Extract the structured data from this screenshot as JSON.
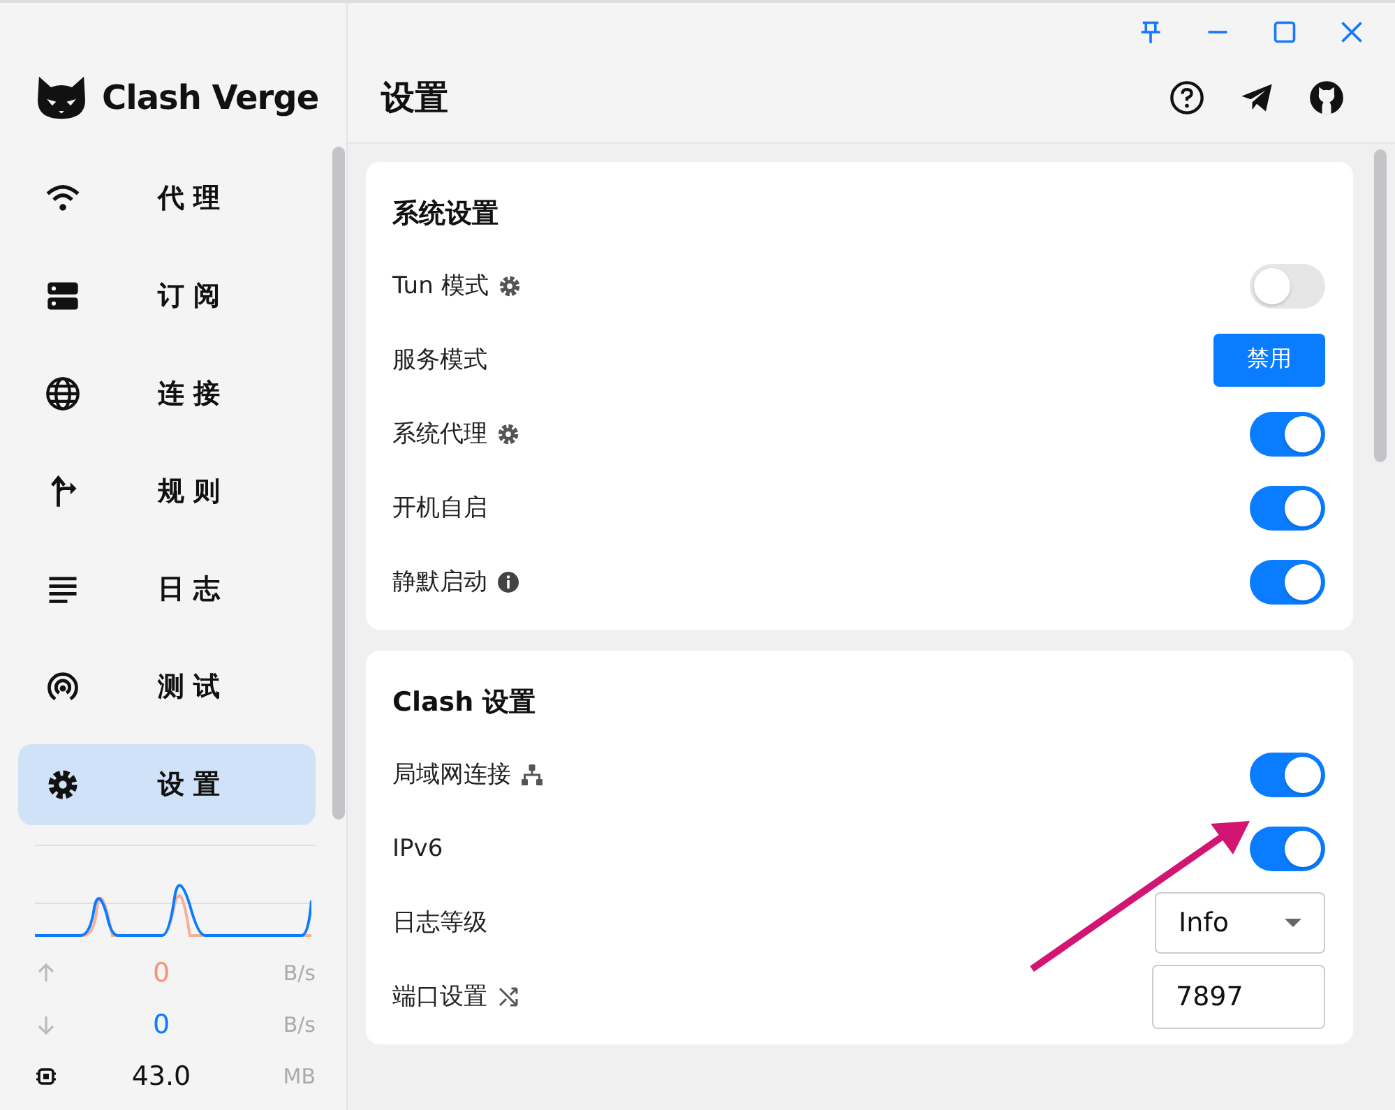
{
  "app": {
    "name": "Clash Verge"
  },
  "nav": [
    {
      "label": "代 理",
      "selected": false
    },
    {
      "label": "订 阅",
      "selected": false
    },
    {
      "label": "连 接",
      "selected": false
    },
    {
      "label": "规 则",
      "selected": false
    },
    {
      "label": "日 志",
      "selected": false
    },
    {
      "label": "测 试",
      "selected": false
    },
    {
      "label": "设 置",
      "selected": true
    }
  ],
  "traffic": {
    "upload": {
      "value": "0",
      "unit": "B/s"
    },
    "download": {
      "value": "0",
      "unit": "B/s"
    },
    "memory": {
      "value": "43.0",
      "unit": "MB"
    }
  },
  "page": {
    "title": "设置"
  },
  "sections": [
    {
      "title": "系统设置",
      "rows": [
        {
          "label": "Tun 模式",
          "kind": "switch",
          "on": false
        },
        {
          "label": "服务模式",
          "kind": "button",
          "value": "禁用"
        },
        {
          "label": "系统代理",
          "kind": "switch",
          "on": true
        },
        {
          "label": "开机自启",
          "kind": "switch",
          "on": true
        },
        {
          "label": "静默启动",
          "kind": "switch",
          "on": true
        }
      ]
    },
    {
      "title": "Clash 设置",
      "rows": [
        {
          "label": "局域网连接",
          "kind": "switch",
          "on": true
        },
        {
          "label": "IPv6",
          "kind": "switch",
          "on": true
        },
        {
          "label": "日志等级",
          "kind": "select",
          "value": "Info"
        },
        {
          "label": "端口设置",
          "kind": "input",
          "value": "7897"
        }
      ]
    }
  ]
}
